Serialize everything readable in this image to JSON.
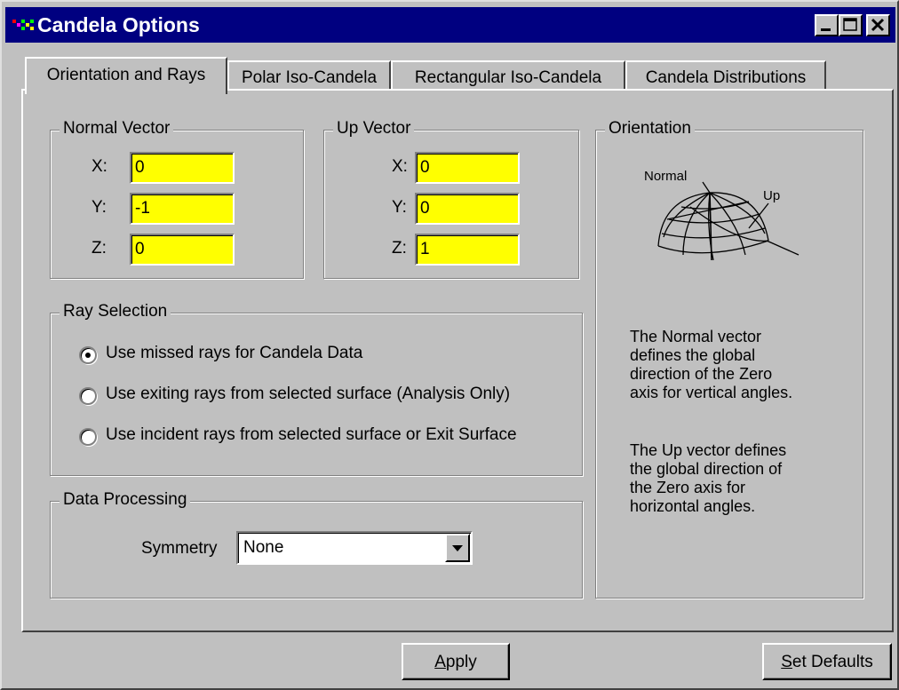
{
  "window": {
    "title": "Candela Options"
  },
  "tabs": [
    {
      "label": "Orientation and Rays",
      "active": true
    },
    {
      "label": "Polar Iso-Candela",
      "active": false
    },
    {
      "label": "Rectangular Iso-Candela",
      "active": false
    },
    {
      "label": "Candela Distributions",
      "active": false
    }
  ],
  "normal_vector": {
    "title": "Normal Vector",
    "x_label": "X:",
    "y_label": "Y:",
    "z_label": "Z:",
    "x": "0",
    "y": "-1",
    "z": "0"
  },
  "up_vector": {
    "title": "Up Vector",
    "x_label": "X:",
    "y_label": "Y:",
    "z_label": "Z:",
    "x": "0",
    "y": "0",
    "z": "1"
  },
  "ray_selection": {
    "title": "Ray Selection",
    "options": [
      {
        "label": "Use missed rays for Candela Data",
        "checked": true
      },
      {
        "label": "Use exiting rays from selected surface (Analysis Only)",
        "checked": false
      },
      {
        "label": "Use incident rays from selected surface or Exit Surface",
        "checked": false
      }
    ]
  },
  "data_processing": {
    "title": "Data Processing",
    "symmetry_label": "Symmetry",
    "symmetry_value": "None"
  },
  "orientation": {
    "title": "Orientation",
    "diagram_normal_label": "Normal",
    "diagram_up_label": "Up",
    "desc_1": [
      "The Normal vector",
      "defines the global",
      "direction of the Zero",
      "axis for vertical angles."
    ],
    "desc_2": [
      "The Up vector defines",
      "the global direction of",
      "the Zero axis for",
      "horizontal angles."
    ]
  },
  "buttons": {
    "apply_mnemonic": "A",
    "apply_rest": "pply",
    "set_defaults_mnemonic": "S",
    "set_defaults_rest": "et Defaults"
  },
  "colors": {
    "titlebar": "#000080",
    "field_bg": "#ffff00",
    "face": "#c0c0c0"
  },
  "icons": [
    "app-icon",
    "minimize-icon",
    "maximize-icon",
    "close-icon",
    "dropdown-arrow-icon"
  ]
}
